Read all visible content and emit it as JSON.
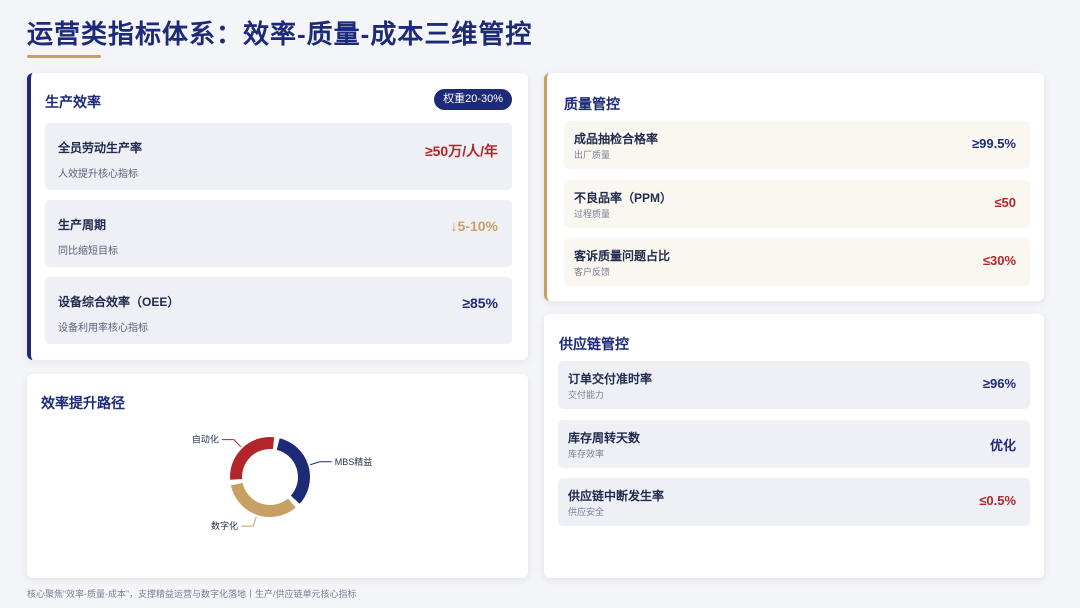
{
  "page": {
    "title": "运营类指标体系：效率-质量-成本三维管控",
    "footer": "核心聚焦“效率-质量-成本”，支撑精益运营与数字化落地丨生产/供应链单元核心指标"
  },
  "colors": {
    "navy": "#1c2a78",
    "red": "#b3242b",
    "gold": "#c9a063"
  },
  "efficiency": {
    "title": "生产效率",
    "badge": "权重20-30%",
    "items": [
      {
        "name": "全员劳动生产率",
        "sub": "人效提升核心指标",
        "value": "≥50万/人/年",
        "color": "red"
      },
      {
        "name": "生产周期",
        "sub": "同比缩短目标",
        "value": "↓5-10%",
        "color": "gold"
      },
      {
        "name": "设备综合效率（OEE）",
        "sub": "设备利用率核心指标",
        "value": "≥85%",
        "color": "navy"
      }
    ]
  },
  "path": {
    "title": "效率提升路径",
    "segments": [
      {
        "name": "MBS精益",
        "share": 0.35,
        "color": "#1c2a78"
      },
      {
        "name": "数字化",
        "share": 0.35,
        "color": "#c9a063"
      },
      {
        "name": "自动化",
        "share": 0.3,
        "color": "#b3242b"
      }
    ]
  },
  "quality": {
    "title": "质量管控",
    "items": [
      {
        "name": "成品抽检合格率",
        "sub": "出厂质量",
        "value": "≥99.5%",
        "color": "navy"
      },
      {
        "name": "不良品率（PPM）",
        "sub": "过程质量",
        "value": "≤50",
        "color": "red"
      },
      {
        "name": "客诉质量问题占比",
        "sub": "客户反馈",
        "value": "≤30%",
        "color": "red"
      }
    ]
  },
  "supply": {
    "title": "供应链管控",
    "items": [
      {
        "name": "订单交付准时率",
        "sub": "交付能力",
        "value": "≥96%",
        "color": "navy"
      },
      {
        "name": "库存周转天数",
        "sub": "库存效率",
        "value": "优化",
        "color": "navy"
      },
      {
        "name": "供应链中断发生率",
        "sub": "供应安全",
        "value": "≤0.5%",
        "color": "red"
      }
    ]
  }
}
